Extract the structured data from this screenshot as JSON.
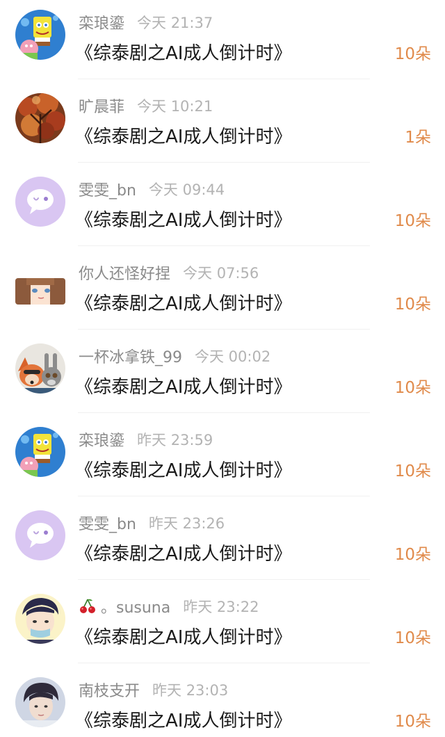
{
  "entries": [
    {
      "name": "栾琅鎏",
      "time": "今天 21:37",
      "title": "《综泰剧之AI成人倒计时》",
      "count": "10朵",
      "avatar": "spongebob"
    },
    {
      "name": "旷晨菲",
      "time": "今天 10:21",
      "title": "《综泰剧之AI成人倒计时》",
      "count": "1朵",
      "avatar": "autumn-tree"
    },
    {
      "name": "雯雯_bn",
      "time": "今天 09:44",
      "title": "《综泰剧之AI成人倒计时》",
      "count": "10朵",
      "avatar": "chat-bubble"
    },
    {
      "name": "你人还怪好捏",
      "time": "今天 07:56",
      "title": "《综泰剧之AI成人倒计时》",
      "count": "10朵",
      "avatar": "anime-face"
    },
    {
      "name": "一杯冰拿铁_99",
      "time": "今天 00:02",
      "title": "《综泰剧之AI成人倒计时》",
      "count": "10朵",
      "avatar": "fox-bunny"
    },
    {
      "name": "栾琅鎏",
      "time": "昨天 23:59",
      "title": "《综泰剧之AI成人倒计时》",
      "count": "10朵",
      "avatar": "spongebob"
    },
    {
      "name": "雯雯_bn",
      "time": "昨天 23:26",
      "title": "《综泰剧之AI成人倒计时》",
      "count": "10朵",
      "avatar": "chat-bubble"
    },
    {
      "name": "。susuna",
      "time": "昨天 23:22",
      "title": "《综泰剧之AI成人倒计时》",
      "count": "10朵",
      "avatar": "anime-boy",
      "prefix_icon": "cherry-icon"
    },
    {
      "name": "南枝支开",
      "time": "昨天 23:03",
      "title": "《综泰剧之AI成人倒计时》",
      "count": "10朵",
      "avatar": "portrait"
    }
  ],
  "colors": {
    "name": "#8a8a8a",
    "time": "#b3b3b3",
    "title": "#1a1a1a",
    "count": "#e08a4a",
    "bubble_avatar": "#d9c6f2"
  }
}
